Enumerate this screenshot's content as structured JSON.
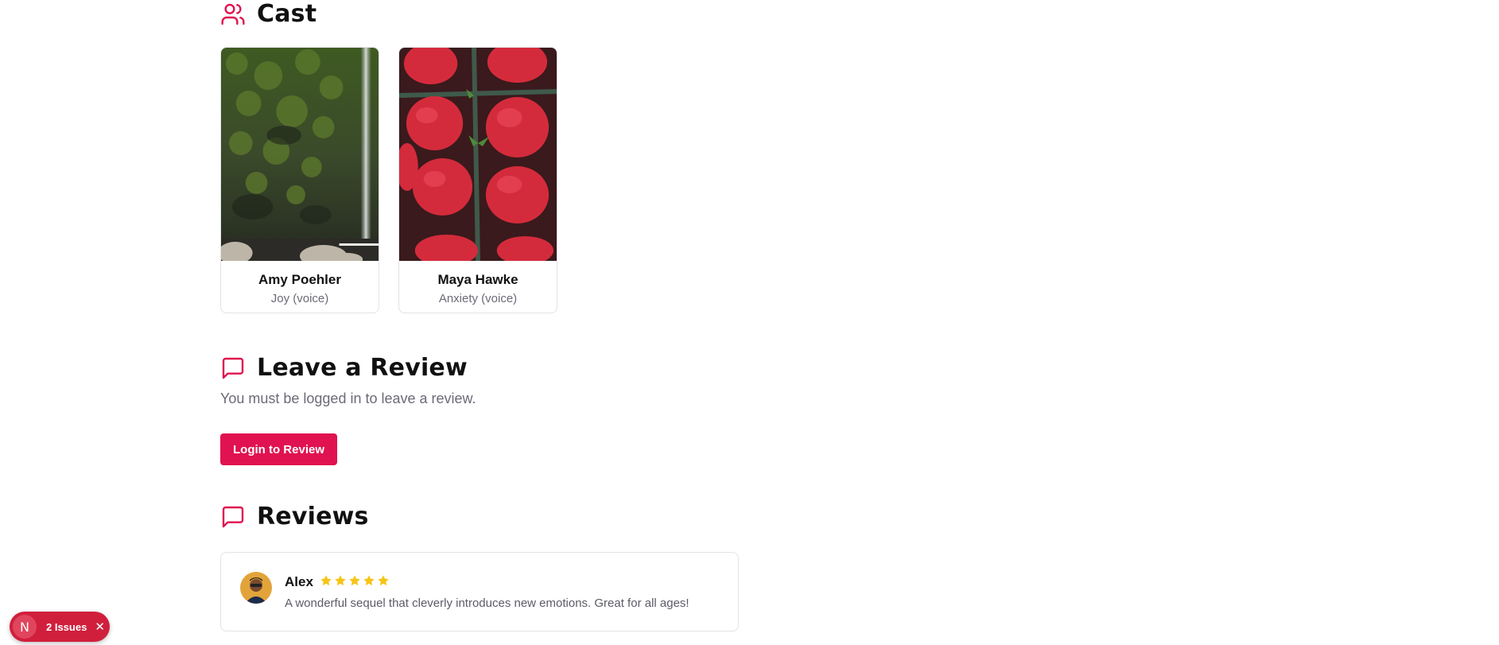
{
  "colors": {
    "accent": "#e0124f",
    "badge": "#d01f3c",
    "star": "#f5c518",
    "muted_text": "#6b6b78"
  },
  "cast": {
    "heading": "Cast",
    "heading_icon": "users-icon",
    "members": [
      {
        "name": "Amy Poehler",
        "role": "Joy (voice)",
        "photo": "mossy-waterfall-photo"
      },
      {
        "name": "Maya Hawke",
        "role": "Anxiety (voice)",
        "photo": "strawberries-photo"
      }
    ]
  },
  "leave_review": {
    "heading": "Leave a Review",
    "heading_icon": "message-square-icon",
    "login_note": "You must be logged in to leave a review.",
    "login_button": "Login to Review"
  },
  "reviews": {
    "heading": "Reviews",
    "heading_icon": "message-square-icon",
    "items": [
      {
        "author": "Alex",
        "rating": 5,
        "text": "A wonderful sequel that cleverly introduces new emotions. Great for all ages!"
      }
    ]
  },
  "dev_overlay": {
    "logo": "N",
    "issues_label": "2 Issues",
    "close_glyph": "✕"
  }
}
